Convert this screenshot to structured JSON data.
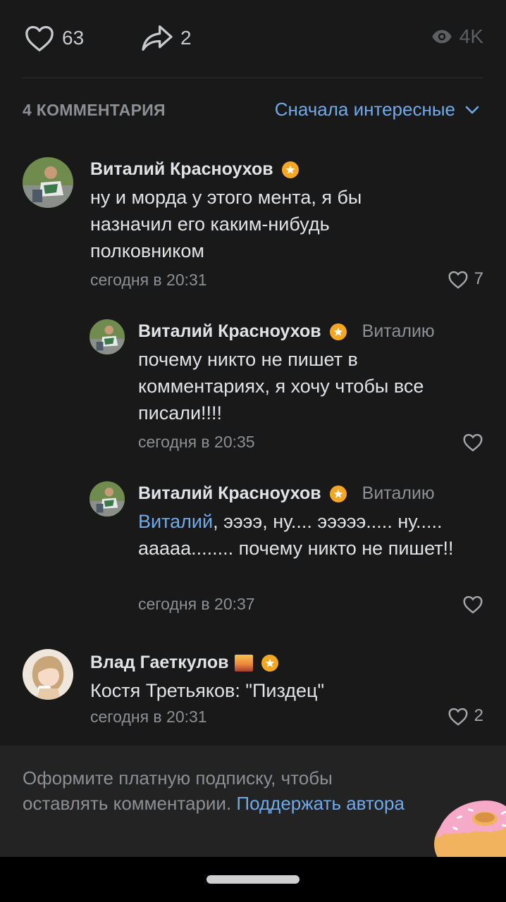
{
  "stats": {
    "likes": "63",
    "shares": "2",
    "views": "4K"
  },
  "comments_header": {
    "count_label": "4 КОММЕНТАРИЯ",
    "sort_label": "Сначала интересные"
  },
  "comments": [
    {
      "author": "Виталий Красноухов",
      "text": "ну и морда у этого мента, я бы назначил его каким-нибудь полковником",
      "time": "сегодня в 20:31",
      "likes": "7"
    },
    {
      "author": "Виталий Красноухов",
      "reply_to": "Виталию",
      "text": "почему никто не пишет в комментариях, я хочу чтобы все писали!!!!",
      "time": "сегодня в 20:35",
      "likes": ""
    },
    {
      "author": "Виталий Красноухов",
      "reply_to": "Виталию",
      "mention": "Виталий",
      "text": ", ээээ, ну.... эээээ..... ну..... ааааа........ почему никто не пишет!!",
      "time": "сегодня в 20:37",
      "likes": ""
    },
    {
      "author": "Влад Гаеткулов",
      "text": "Костя Третьяков: \"Пиздец\"",
      "time": "сегодня в 20:31",
      "likes": "2"
    }
  ],
  "footer": {
    "text": "Оформите платную подписку, чтобы оставлять комментарии.",
    "link": "Поддержать автора"
  },
  "colors": {
    "background": "#191919",
    "accent": "#71aaeb",
    "badge": "#f5a623",
    "muted": "#8c8f93"
  }
}
